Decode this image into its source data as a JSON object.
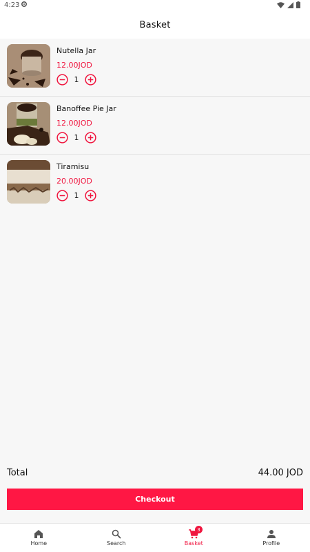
{
  "status_bar": {
    "time": "4:23"
  },
  "header": {
    "title": "Basket"
  },
  "items": [
    {
      "name": "Nutella Jar",
      "price": "12.00JOD",
      "quantity": "1"
    },
    {
      "name": "Banoffee Pie Jar",
      "price": "12.00JOD",
      "quantity": "1"
    },
    {
      "name": "Tiramisu",
      "price": "20.00JOD",
      "quantity": "1"
    }
  ],
  "summary": {
    "total_label": "Total",
    "total_value": "44.00 JOD"
  },
  "checkout": {
    "label": "Checkout"
  },
  "nav": {
    "home": "Home",
    "search": "Search",
    "basket": "Basket",
    "profile": "Profile",
    "basket_badge": "3"
  },
  "colors": {
    "accent": "#ff1744",
    "price": "#f0163f"
  }
}
